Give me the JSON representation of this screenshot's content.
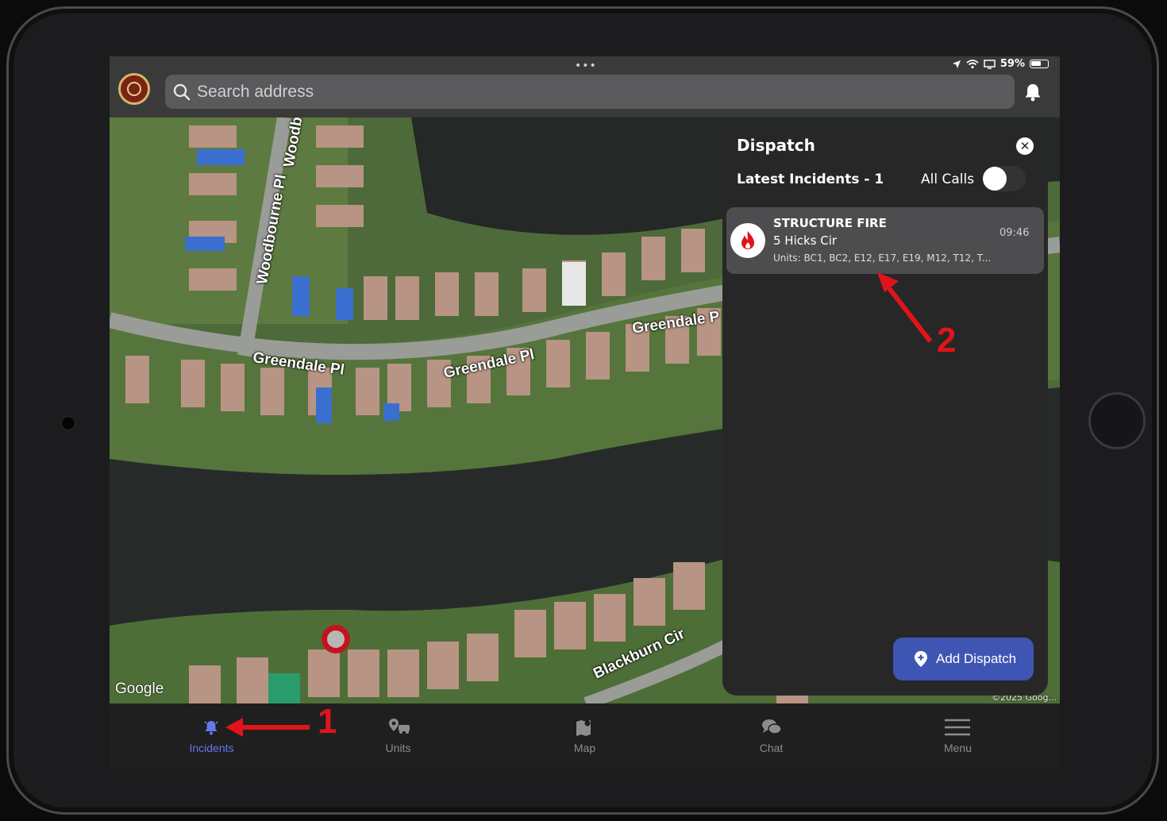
{
  "status_bar": {
    "battery": "59%"
  },
  "search": {
    "placeholder": "Search address"
  },
  "map": {
    "attribution_logo": "Google",
    "copyright": "©2025 Goog...",
    "streets": [
      "Woodbourne Pl",
      "Woodb",
      "Greendale Pl",
      "Greendale Pl",
      "Greendale P",
      "Blackburn Cir"
    ]
  },
  "dispatch": {
    "title": "Dispatch",
    "latest_label": "Latest Incidents - 1",
    "all_calls_label": "All Calls",
    "all_calls_on": false,
    "incidents": [
      {
        "type": "STRUCTURE FIRE",
        "address": "5 Hicks Cir",
        "units": "Units: BC1, BC2, E12, E17, E19, M12, T12, T...",
        "time": "09:46",
        "icon": "fire-icon"
      }
    ],
    "add_button": "Add Dispatch"
  },
  "tabs": [
    {
      "label": "Incidents",
      "icon": "bell-icon",
      "active": true
    },
    {
      "label": "Units",
      "icon": "units-icon",
      "active": false
    },
    {
      "label": "Map",
      "icon": "map-icon",
      "active": false
    },
    {
      "label": "Chat",
      "icon": "chat-icon",
      "active": false
    },
    {
      "label": "Menu",
      "icon": "menu-icon",
      "active": false
    }
  ],
  "annotations": [
    "1",
    "2"
  ],
  "colors": {
    "accent": "#3f55b3",
    "active_tab": "#6478e8",
    "annotation": "#e0141a"
  }
}
